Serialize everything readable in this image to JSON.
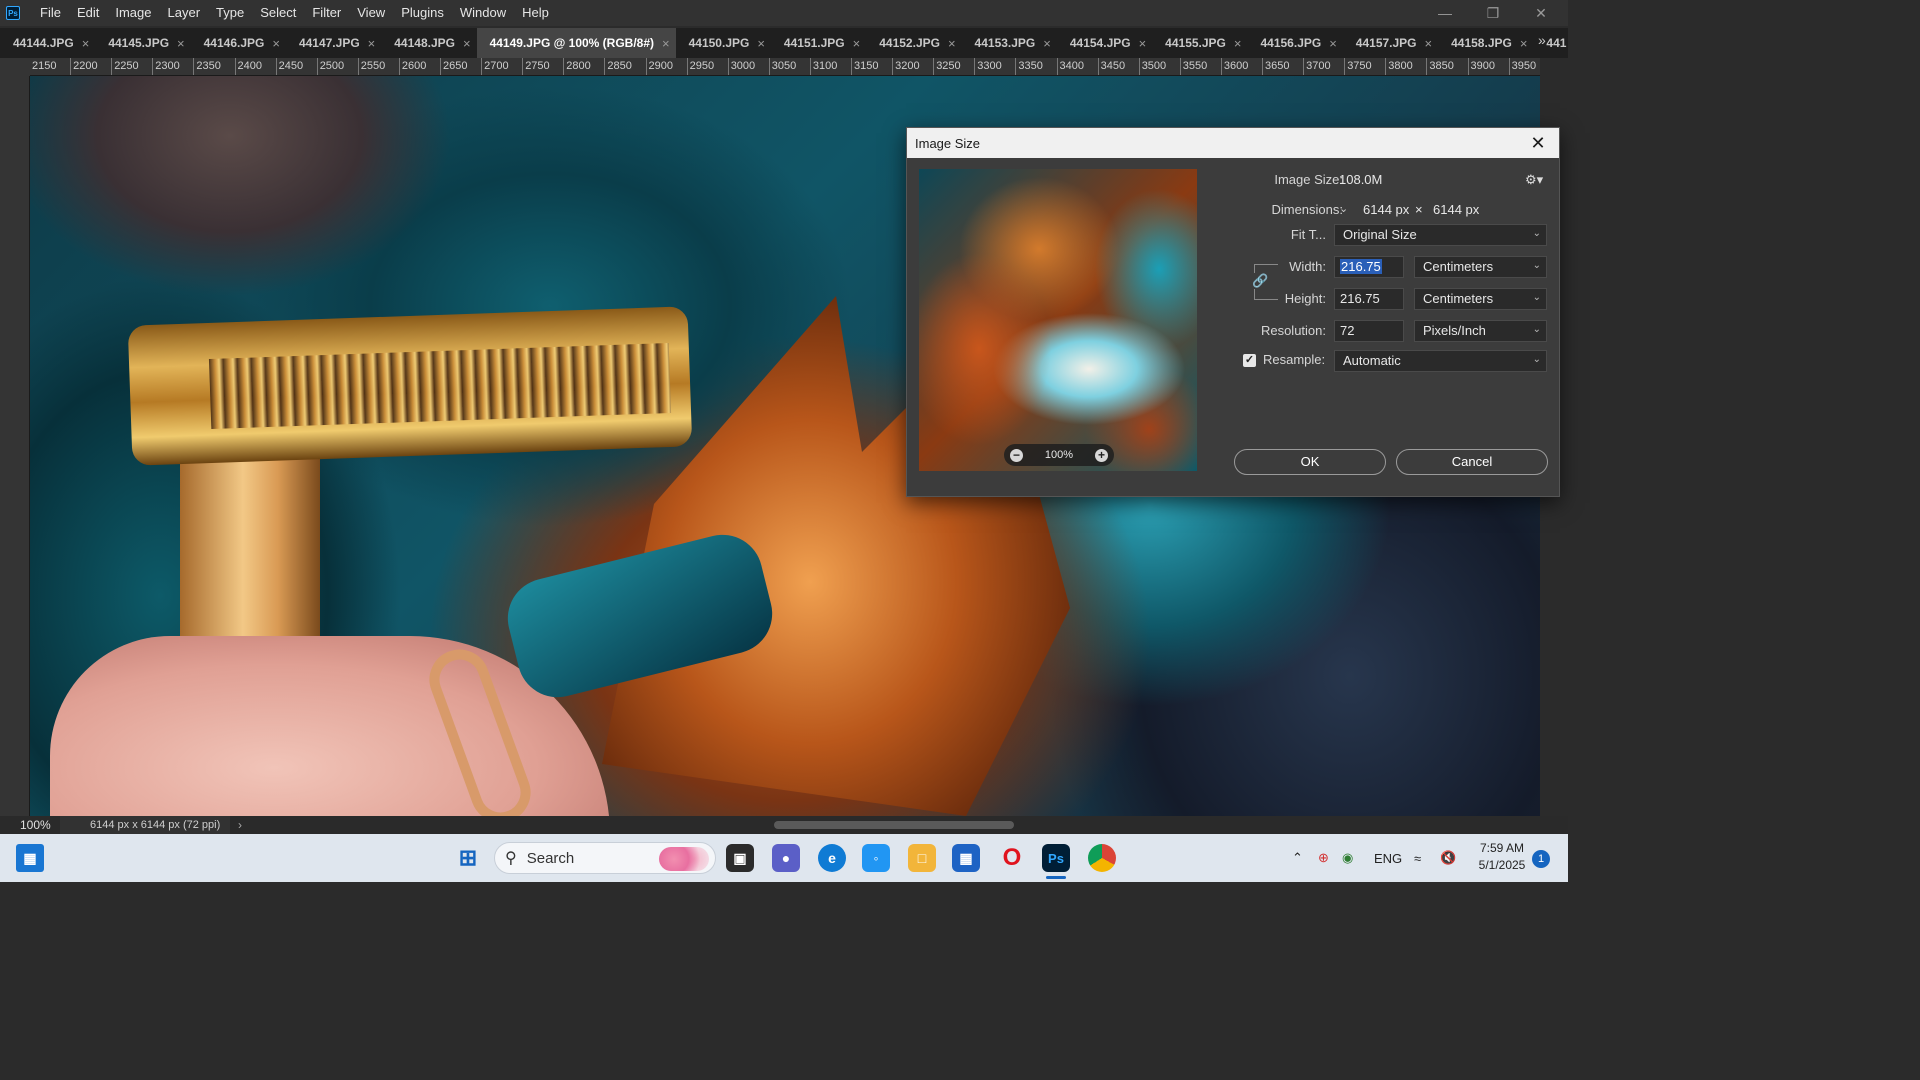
{
  "app": {
    "logo": "Ps"
  },
  "menu": [
    "File",
    "Edit",
    "Image",
    "Layer",
    "Type",
    "Select",
    "Filter",
    "View",
    "Plugins",
    "Window",
    "Help"
  ],
  "tabs": [
    {
      "label": "44144.JPG",
      "active": false
    },
    {
      "label": "44145.JPG",
      "active": false
    },
    {
      "label": "44146.JPG",
      "active": false
    },
    {
      "label": "44147.JPG",
      "active": false
    },
    {
      "label": "44148.JPG",
      "active": false
    },
    {
      "label": "44149.JPG @ 100% (RGB/8#)",
      "active": true
    },
    {
      "label": "44150.JPG",
      "active": false
    },
    {
      "label": "44151.JPG",
      "active": false
    },
    {
      "label": "44152.JPG",
      "active": false
    },
    {
      "label": "44153.JPG",
      "active": false
    },
    {
      "label": "44154.JPG",
      "active": false
    },
    {
      "label": "44155.JPG",
      "active": false
    },
    {
      "label": "44156.JPG",
      "active": false
    },
    {
      "label": "44157.JPG",
      "active": false
    },
    {
      "label": "44158.JPG",
      "active": false
    },
    {
      "label": "441",
      "active": false
    }
  ],
  "ruler": {
    "top_ticks": [
      "2150",
      "2200",
      "2250",
      "2300",
      "2350",
      "2400",
      "2450",
      "2500",
      "2550",
      "2600",
      "2650",
      "2700",
      "2750",
      "2800",
      "2850",
      "2900",
      "2950",
      "3000",
      "3050",
      "3100",
      "3150",
      "3200",
      "3250",
      "3300",
      "3350",
      "3400",
      "3450",
      "3500",
      "3550",
      "3600",
      "3650",
      "3700",
      "3750",
      "3800",
      "3850",
      "3900",
      "3950"
    ]
  },
  "status": {
    "zoom": "100%",
    "doc_info": "6144 px x 6144 px (72 ppi)"
  },
  "dialog": {
    "title": "Image Size",
    "preview_zoom": "100%",
    "image_size_label": "Image Size:",
    "image_size_value": "108.0M",
    "dimensions_label": "Dimensions:",
    "dim_w": "6144 px",
    "dim_x": "×",
    "dim_h": "6144 px",
    "fit_label": "Fit T...",
    "fit_value": "Original Size",
    "width_label": "Width:",
    "width_value": "216.75",
    "width_unit": "Centimeters",
    "height_label": "Height:",
    "height_value": "216.75",
    "height_unit": "Centimeters",
    "resolution_label": "Resolution:",
    "resolution_value": "72",
    "resolution_unit": "Pixels/Inch",
    "resample_label": "Resample:",
    "resample_checked": true,
    "resample_value": "Automatic",
    "ok_label": "OK",
    "cancel_label": "Cancel"
  },
  "taskbar": {
    "search_label": "Search",
    "language": "ENG",
    "time": "7:59 AM",
    "date": "5/1/2025",
    "notification_count": "1"
  },
  "colors": {
    "accent": "#31a8ff",
    "selection": "#2a5fb8",
    "taskbar": "#dfe6ee"
  }
}
